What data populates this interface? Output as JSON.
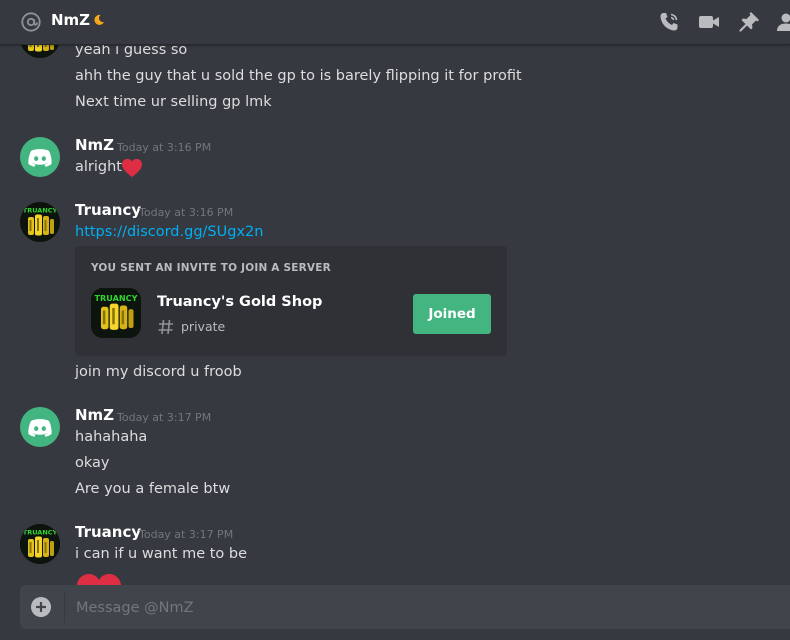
{
  "header": {
    "title": "NmZ",
    "icons": [
      "at-icon",
      "moon-icon",
      "call-icon",
      "video-icon",
      "pin-icon",
      "members-icon"
    ]
  },
  "messages": [
    {
      "type": "continuation",
      "lines": [
        "yeah i guess so",
        "ahh the guy that u sold the gp to is barely flipping it for profit",
        "Next time ur selling gp lmk"
      ]
    },
    {
      "type": "group",
      "author": "NmZ",
      "avatar": "discord-avatar",
      "time": "Today at 3:16 PM",
      "lines": [
        "alright"
      ],
      "emoji": "heart"
    },
    {
      "type": "group",
      "author": "Truancy",
      "avatar": "truancy-avatar",
      "time": "Today at 3:16 PM",
      "link": "https://discord.gg/SUgx2n",
      "invite": {
        "header": "YOU SENT AN INVITE TO JOIN A SERVER",
        "server_name": "Truancy's Gold Shop",
        "channel": "private",
        "button": "Joined",
        "icon_text": "TRUANCY"
      },
      "after": "join my discord u froob"
    },
    {
      "type": "group",
      "author": "NmZ",
      "avatar": "discord-avatar",
      "time": "Today at 3:17 PM",
      "lines": [
        "hahahaha",
        "okay",
        "Are you a female btw"
      ]
    },
    {
      "type": "group",
      "author": "Truancy",
      "avatar": "truancy-avatar",
      "time": "Today at 3:17 PM",
      "lines": [
        "i can if u want me to be"
      ],
      "emoji": "heart"
    }
  ],
  "composer": {
    "placeholder": "Message @NmZ"
  },
  "colors": {
    "background": "#36393f",
    "accent": "#43b581",
    "link": "#00b0f4",
    "heart": "#dd2e44"
  }
}
